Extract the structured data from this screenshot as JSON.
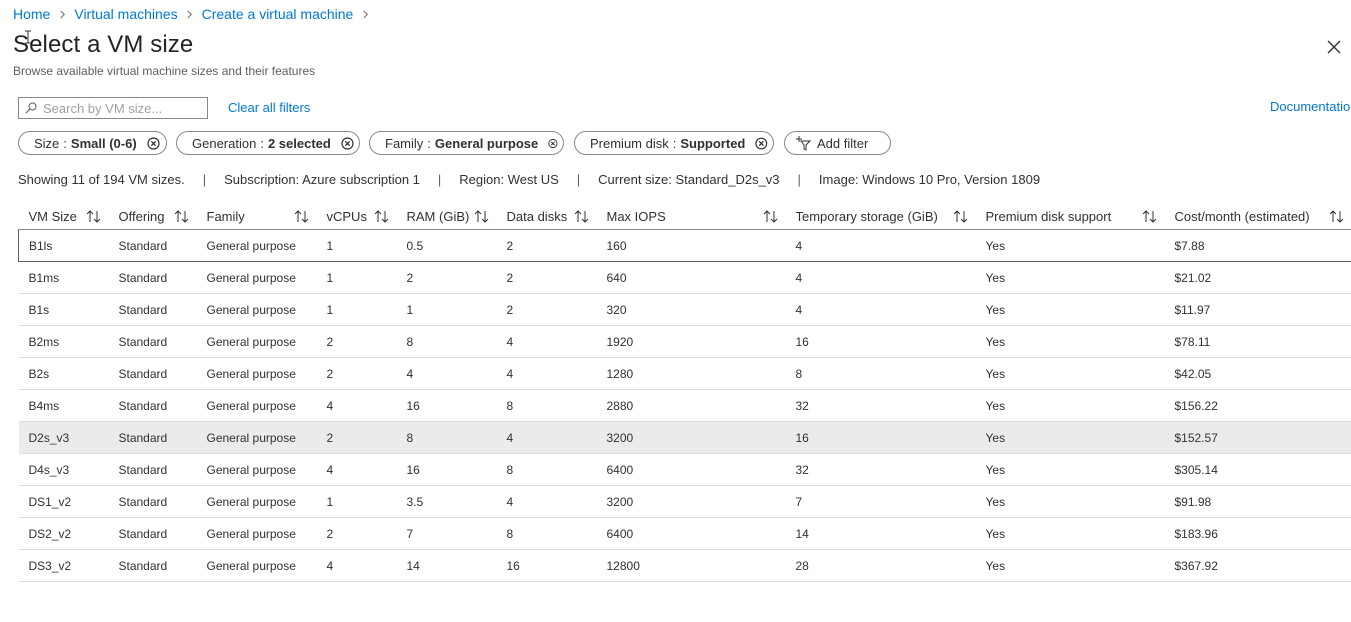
{
  "breadcrumb": [
    "Home",
    "Virtual machines",
    "Create a virtual machine"
  ],
  "title": "Select a VM size",
  "subtitle": "Browse available virtual machine sizes and their features",
  "search": {
    "placeholder": "Search by VM size...",
    "value": ""
  },
  "clear_filters_label": "Clear all filters",
  "documentation_label": "Documentatio",
  "filters": [
    {
      "key": "Size",
      "value": "Small (0-6)"
    },
    {
      "key": "Generation",
      "value": "2 selected"
    },
    {
      "key": "Family",
      "value": "General purpose"
    },
    {
      "key": "Premium disk",
      "value": "Supported"
    }
  ],
  "add_filter_label": "Add filter",
  "summary": {
    "showing": "Showing 11 of 194 VM sizes.",
    "subscription": "Subscription: Azure subscription 1",
    "region": "Region: West US",
    "current_size": "Current size: Standard_D2s_v3",
    "image": "Image: Windows 10 Pro, Version 1809",
    "divider": "|"
  },
  "columns": [
    "VM Size",
    "Offering",
    "Family",
    "vCPUs",
    "RAM (GiB)",
    "Data disks",
    "Max IOPS",
    "Temporary storage (GiB)",
    "Premium disk support",
    "Cost/month (estimated)"
  ],
  "rows": [
    [
      "B1ls",
      "Standard",
      "General purpose",
      "1",
      "0.5",
      "2",
      "160",
      "4",
      "Yes",
      "$7.88"
    ],
    [
      "B1ms",
      "Standard",
      "General purpose",
      "1",
      "2",
      "2",
      "640",
      "4",
      "Yes",
      "$21.02"
    ],
    [
      "B1s",
      "Standard",
      "General purpose",
      "1",
      "1",
      "2",
      "320",
      "4",
      "Yes",
      "$11.97"
    ],
    [
      "B2ms",
      "Standard",
      "General purpose",
      "2",
      "8",
      "4",
      "1920",
      "16",
      "Yes",
      "$78.11"
    ],
    [
      "B2s",
      "Standard",
      "General purpose",
      "2",
      "4",
      "4",
      "1280",
      "8",
      "Yes",
      "$42.05"
    ],
    [
      "B4ms",
      "Standard",
      "General purpose",
      "4",
      "16",
      "8",
      "2880",
      "32",
      "Yes",
      "$156.22"
    ],
    [
      "D2s_v3",
      "Standard",
      "General purpose",
      "2",
      "8",
      "4",
      "3200",
      "16",
      "Yes",
      "$152.57"
    ],
    [
      "D4s_v3",
      "Standard",
      "General purpose",
      "4",
      "16",
      "8",
      "6400",
      "32",
      "Yes",
      "$305.14"
    ],
    [
      "DS1_v2",
      "Standard",
      "General purpose",
      "1",
      "3.5",
      "4",
      "3200",
      "7",
      "Yes",
      "$91.98"
    ],
    [
      "DS2_v2",
      "Standard",
      "General purpose",
      "2",
      "7",
      "8",
      "6400",
      "14",
      "Yes",
      "$183.96"
    ],
    [
      "DS3_v2",
      "Standard",
      "General purpose",
      "4",
      "14",
      "16",
      "12800",
      "28",
      "Yes",
      "$367.92"
    ]
  ],
  "focused_row": 0,
  "hovered_row": 6,
  "icons": {
    "breadcrumb_separator": "chevron-right-icon",
    "close": "close-icon",
    "search": "search-icon",
    "remove_filter": "remove-filter-icon",
    "add_filter": "add-filter-icon",
    "sort": "sort-icon",
    "cursor": "text-cursor-icon"
  },
  "colors": {
    "link": "#0078d4",
    "text": "#323130",
    "border": "#8a8886",
    "row_hover": "#edebe9"
  }
}
